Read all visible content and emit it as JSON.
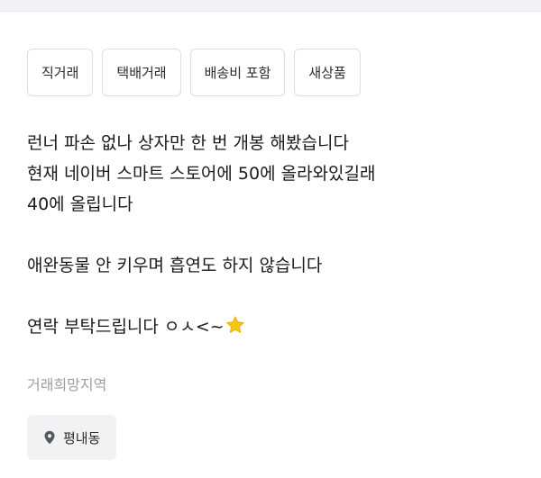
{
  "tags": [
    "직거래",
    "택배거래",
    "배송비 포함",
    "새상품"
  ],
  "description": {
    "line1": "런너 파손 없나 상자만 한 번 개봉 해봤습니다",
    "line2": "현재 네이버 스마트 스토어에 50에 올라와있길래",
    "line3": "40에 올립니다",
    "line4": "애완동물 안 키우며 흡연도 하지 않습니다",
    "line5": "연락 부탁드립니다 ㅇㅅ<~",
    "star_icon": "star-emoji"
  },
  "region": {
    "label": "거래희망지역",
    "value": "평내동",
    "icon": "location-pin-icon"
  },
  "colors": {
    "tag_border": "#dcdee3",
    "chip_bg": "#f1f2f4",
    "muted_text": "#9a9ea6",
    "star": "#f5c518"
  }
}
